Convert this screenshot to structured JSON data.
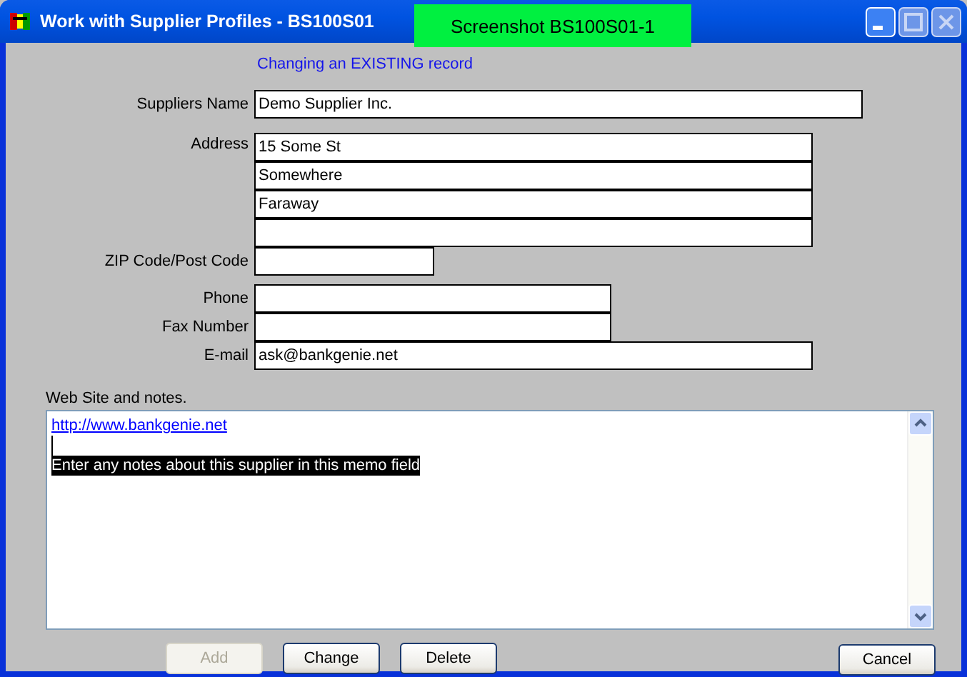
{
  "window": {
    "title": "Work with Supplier Profiles - BS100S01"
  },
  "badge": "Screenshot BS100S01-1",
  "status": "Changing an EXISTING record",
  "fields": [
    {
      "kind": "text",
      "label": "Suppliers Name",
      "value": "Demo Supplier Inc."
    },
    {
      "kind": "text",
      "label": "Address",
      "value": "15 Some St"
    },
    {
      "kind": "text",
      "value": "Somewhere"
    },
    {
      "kind": "text",
      "value": "Faraway"
    },
    {
      "kind": "text"
    },
    {
      "kind": "text",
      "label": "ZIP Code/Post Code"
    },
    {
      "kind": "text",
      "label": "Phone"
    },
    {
      "kind": "text",
      "label": "Fax Number"
    },
    {
      "kind": "text",
      "label": "E-mail",
      "value": "ask@bankgenie.net"
    }
  ],
  "notes": {
    "label": "Web Site and notes.",
    "lines": [
      {
        "kind": "link",
        "text": "http://www.bankgenie.net "
      },
      {
        "kind": "blank"
      },
      {
        "kind": "selected",
        "text": "Enter any notes about this supplier in this memo field"
      }
    ]
  },
  "buttons": [
    {
      "label": "Add",
      "disabled": true
    },
    {
      "label": "Change",
      "disabled": false
    },
    {
      "label": "Delete",
      "disabled": false
    }
  ],
  "cancel": {
    "label": "Cancel",
    "disabled": false
  }
}
